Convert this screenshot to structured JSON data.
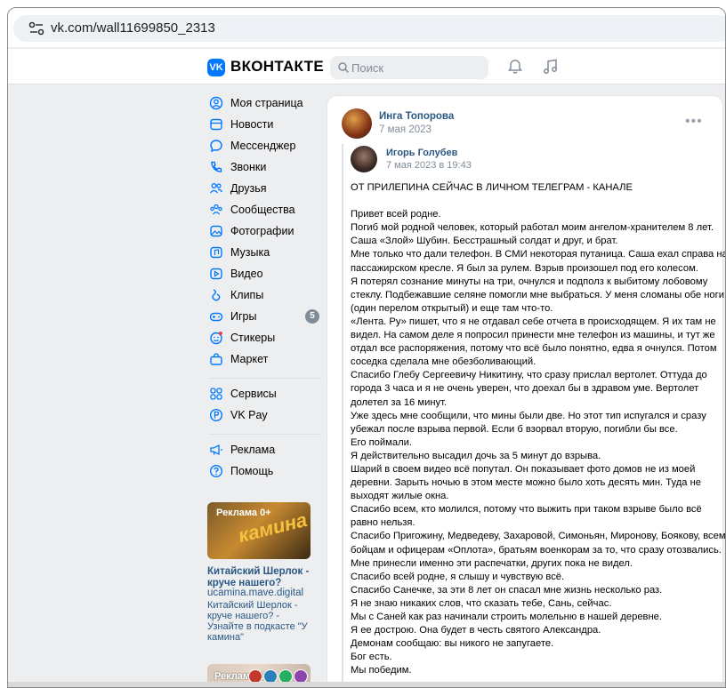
{
  "browser": {
    "url": "vk.com/wall11699850_2313"
  },
  "header": {
    "brand": "ВКОНТАКТЕ",
    "search_placeholder": "Поиск"
  },
  "sidebar": {
    "items": [
      {
        "label": "Моя страница",
        "icon": "profile-icon"
      },
      {
        "label": "Новости",
        "icon": "news-icon"
      },
      {
        "label": "Мессенджер",
        "icon": "messenger-icon"
      },
      {
        "label": "Звонки",
        "icon": "phone-icon"
      },
      {
        "label": "Друзья",
        "icon": "friends-icon"
      },
      {
        "label": "Сообщества",
        "icon": "communities-icon"
      },
      {
        "label": "Фотографии",
        "icon": "photos-icon"
      },
      {
        "label": "Музыка",
        "icon": "music-icon"
      },
      {
        "label": "Видео",
        "icon": "video-icon"
      },
      {
        "label": "Клипы",
        "icon": "clips-icon"
      },
      {
        "label": "Игры",
        "icon": "games-icon",
        "badge": "5"
      },
      {
        "label": "Стикеры",
        "icon": "stickers-icon"
      },
      {
        "label": "Маркет",
        "icon": "market-icon"
      }
    ],
    "items2": [
      {
        "label": "Сервисы",
        "icon": "services-icon"
      },
      {
        "label": "VK Pay",
        "icon": "vkpay-icon"
      }
    ],
    "items3": [
      {
        "label": "Реклама",
        "icon": "ads-icon"
      },
      {
        "label": "Помощь",
        "icon": "help-icon"
      }
    ]
  },
  "ad": {
    "tag": "Реклама 0+",
    "art": "камина",
    "title": "Китайский Шерлок - круче нашего?",
    "domain": "ucamina.mave.digital",
    "desc": "Китайский Шерлок - круче нашего? - Узнайте в подкасте \"У камина\"",
    "tag2": "Реклама 12+"
  },
  "post": {
    "author": "Инга Топорова",
    "date": "7 мая 2023",
    "repost": {
      "author": "Игорь Голубев",
      "date": "7 мая 2023 в 19:43"
    },
    "lines": [
      "ОТ ПРИЛЕПИНА СЕЙЧАС В ЛИЧНОМ ТЕЛЕГРАМ - КАНАЛЕ",
      "",
      "Привет всей родне.",
      "Погиб мой родной человек, который работал моим ангелом-хранителем 8 лет.",
      "Саша «Злой» Шубин. Бесстрашный солдат и друг, и брат.",
      "Мне только что дали телефон. В СМИ некоторая путаница. Саша ехал справа на",
      "пассажирском кресле. Я был за рулем. Взрыв произошел под его колесом.",
      "Я потерял сознание минуты на три, очнулся и подполз к выбитому лобовому",
      "стеклу. Подбежавшие селяне помогли мне выбраться. У меня сломаны обе ноги",
      "(один перелом открытый) и еще там что-то.",
      "«Лента. Ру» пишет, что я не отдавал себе отчета в происходящем. Я их там не",
      "видел. На самом деле я попросил принести мне телефон из машины, и тут же",
      "отдал все распоряжения, потому что всё было понятно, едва я очнулся. Потом",
      "соседка сделала мне обезболивающий.",
      "Спасибо Глебу Сергеевичу Никитину, что сразу прислал вертолет. Оттуда до",
      "города 3 часа и я не очень уверен, что доехал бы в здравом уме. Вертолет",
      "долетел за 16 минут.",
      "Уже здесь мне сообщили, что мины были две. Но этот тип испугался и сразу",
      "убежал после взрыва первой. Если б взорвал вторую, погибли бы все.",
      "Его поймали.",
      "Я действительно высадил дочь за 5 минут до взрыва.",
      "Шарий в своем видео всё попутал. Он показывает фото домов не из моей",
      "деревни. Зарыть ночью в этом месте можно было хоть десять мин. Туда не",
      "выходят жилые окна.",
      "Спасибо всем, кто молился, потому что выжить при таком взрыве было всё",
      "равно нельзя.",
      "Спасибо Пригожину, Медведеву, Захаровой, Симоньян, Миронову, Боякову, всем",
      "бойцам и офицерам «Оплота», братьям военкорам за то, что сразу отозвались.",
      "Мне принесли именно эти распечатки, других пока не видел.",
      "Спасибо всей родне, я слышу и чувствую всё.",
      "Спасибо Санечке, за эти 8 лет он спасал мне жизнь несколько раз.",
      "Я не знаю никаких слов, что сказать тебе, Сань, сейчас.",
      "Мы с Саней как раз начинали строить молельню в нашей деревне.",
      "Я ее дострою. Она будет в честь святого Александра.",
      "Демонам сообщаю: вы никого не запугаете.",
      "Бог есть.",
      "Мы победим."
    ]
  }
}
